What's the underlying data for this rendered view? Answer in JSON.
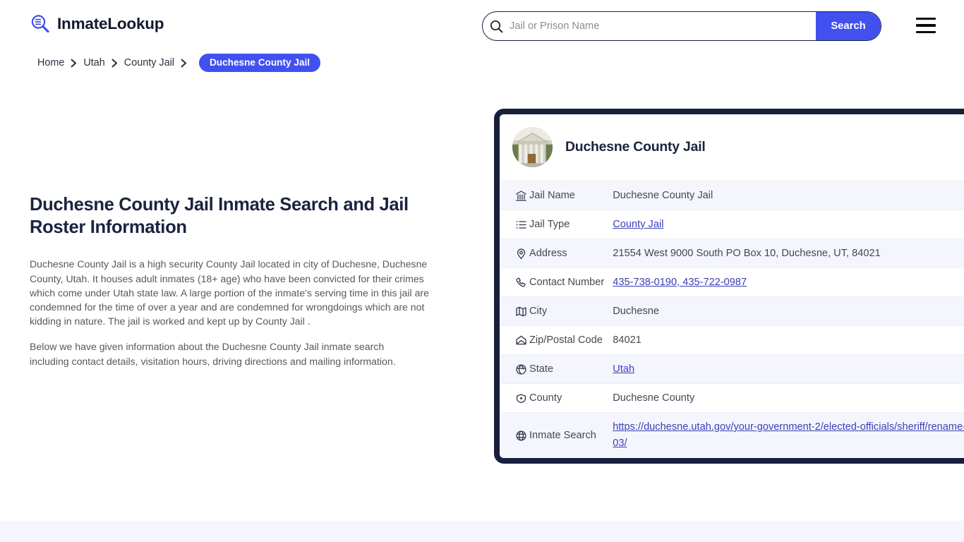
{
  "header": {
    "brand_name": "InmateLookup",
    "brand_icon": "magnifier-list-icon",
    "search": {
      "placeholder": "Jail or Prison Name",
      "value": "",
      "button_label": "Search",
      "icon": "search-icon"
    },
    "menu_icon": "hamburger-menu-icon"
  },
  "breadcrumb": {
    "items": [
      {
        "label": "Home",
        "current": false
      },
      {
        "label": "Utah",
        "current": false
      },
      {
        "label": "County Jail",
        "current": false
      },
      {
        "label": "Duchesne County Jail",
        "current": true
      }
    ],
    "separator_icon": "chevron-right-icon"
  },
  "main": {
    "title": "Duchesne County Jail Inmate Search and Jail Roster Information",
    "paragraphs": [
      "Duchesne County Jail is a high security County Jail located in city of Duchesne, Duchesne County, Utah. It houses adult inmates (18+ age) who have been convicted for their crimes which come under Utah state law. A large portion of the inmate's serving time in this jail are condemned for the time of over a year and are condemned for wrongdoings which are not kidding in nature. The jail is worked and kept up by County Jail .",
      "Below we have given information about the Duchesne County Jail inmate search including contact details, visitation hours, driving directions and mailing information."
    ]
  },
  "card": {
    "title": "Duchesne County Jail",
    "avatar_icon": "courthouse-building-photo",
    "rows": [
      {
        "icon": "bank-building-icon",
        "label": "Jail Name",
        "value": "Duchesne County Jail",
        "link": false
      },
      {
        "icon": "list-icon",
        "label": "Jail Type",
        "value": "County Jail",
        "link": true
      },
      {
        "icon": "map-pin-icon",
        "label": "Address",
        "value": "21554 West 9000 South PO Box 10, Duchesne, UT, 84021",
        "link": false
      },
      {
        "icon": "phone-icon",
        "label": "Contact Number",
        "value": "435-738-0190, 435-722-0987",
        "link": true
      },
      {
        "icon": "map-icon",
        "label": "City",
        "value": "Duchesne",
        "link": false
      },
      {
        "icon": "envelope-icon",
        "label": "Zip/Postal Code",
        "value": "84021",
        "link": false
      },
      {
        "icon": "globe-shield-icon",
        "label": "State",
        "value": "Utah",
        "link": true
      },
      {
        "icon": "county-badge-icon",
        "label": "County",
        "value": "Duchesne County",
        "link": false
      },
      {
        "icon": "globe-icon",
        "label": "Inmate Search",
        "value": "https://duchesne.utah.gov/your-government-2/elected-officials/sheriff/rename-03/",
        "link": true
      }
    ]
  },
  "colors": {
    "accent": "#4250ef",
    "card_border": "#181f3d",
    "link": "#3b3fb5",
    "row_alt": "#f5f6fd",
    "footer_band": "#f5f5fd",
    "heading": "#1b2340"
  }
}
